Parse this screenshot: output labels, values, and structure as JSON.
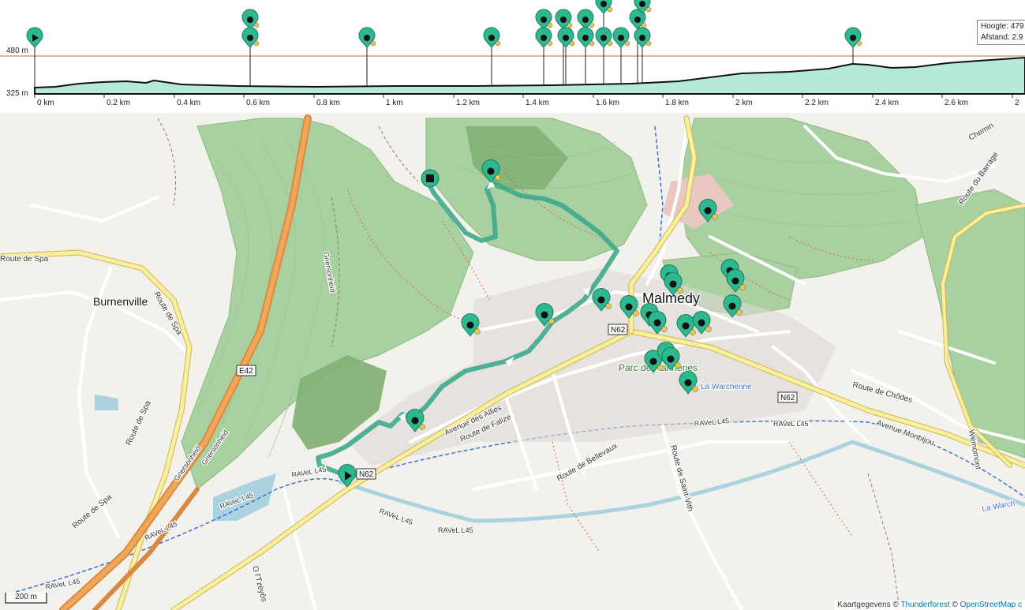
{
  "profile": {
    "y_max_label": "480 m",
    "y_min_label": "325 m",
    "x_ticks": [
      "0 km",
      "0.2 km",
      "0.4 km",
      "0.6 km",
      "0.8 km",
      "1 km",
      "1.2 km",
      "1.4 km",
      "1.6 km",
      "1.8 km",
      "2 km",
      "2.2 km",
      "2.4 km",
      "2.6 km",
      "2"
    ],
    "tooltip": {
      "height": "Hoogte: 479",
      "distance": "Afstand: 2.9"
    }
  },
  "map": {
    "places": {
      "burnenville": "Burnenville",
      "malmedy": "Malmedy",
      "parc": "Parc des tanneries",
      "warchenne": "La Warchenne",
      "warche": "La Warch"
    },
    "roads": {
      "route_de_spa_1": "Route de Spa",
      "route_de_spa_2": "Route de Spa",
      "route_de_spa_3": "Route de Spa",
      "route_de_spa_4": "Route de Spa",
      "gnerson_1": "Gnersonheid",
      "gnerson_2": "Gnersonheid",
      "gnerson_3": "Gnersonheid",
      "allies": "Avenue des Alliés",
      "falize": "Route de Falize",
      "bellevaux": "Route de Bellevaux",
      "saint_vith": "Route de Saint-Vith",
      "chodes": "Route de Chôdes",
      "monbijou": "Avenue Monbijou",
      "wemomont": "Wémomont",
      "route_du_barr": "Route du Barrage",
      "chemin": "Chemin",
      "o_tzeyos": "O l'Tzèyôs",
      "ravel_1": "RAVeL L45",
      "ravel_2": "RAVeL L45",
      "ravel_3": "RAVeL L45",
      "ravel_4": "RAVeL L45",
      "ravel_5": "RAVeL L45",
      "ravel_6": "RAVeL L45",
      "ravel_7": "RAVeL L45",
      "ravel_8": "RAVeL L45"
    },
    "shields": {
      "e42": "E42",
      "n62_1": "N62",
      "n62_2": "N62",
      "n62_3": "N62"
    },
    "scale": "200 m",
    "attribution": {
      "prefix": "Kaartgegevens ©",
      "thunderforest": "Thunderforest",
      "sep": "©",
      "osm": "OpenStreetMap c"
    }
  },
  "colors": {
    "route": "#3daa8c",
    "marker": "#2eb88f",
    "profile_fill": "#b5e9d8"
  }
}
